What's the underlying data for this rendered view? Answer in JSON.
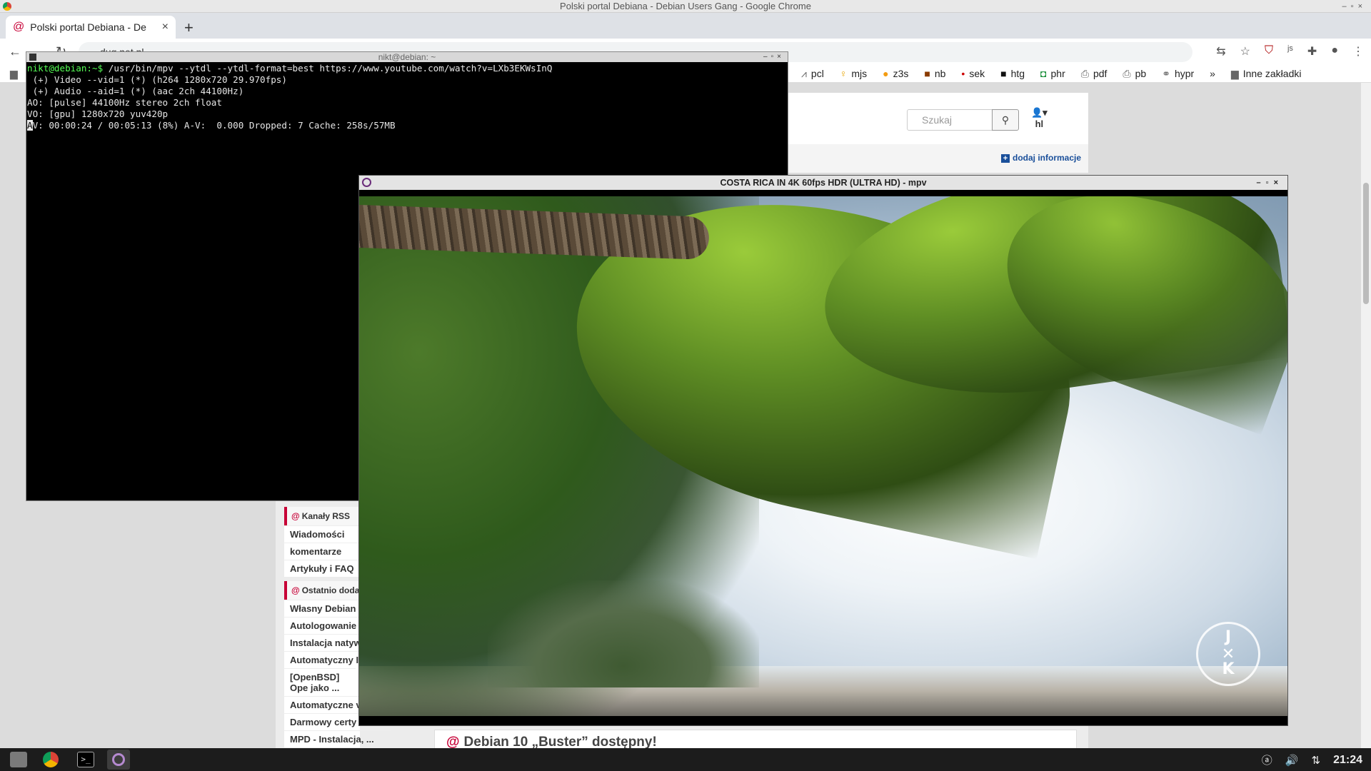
{
  "window": {
    "title": "Polski portal Debiana - Debian Users Gang - Google Chrome"
  },
  "tab": {
    "title": "Polski portal Debiana - De",
    "close": "×",
    "new": "+"
  },
  "toolbar": {
    "url": "dug.net.pl"
  },
  "bookmarks": {
    "items": [
      {
        "label": "pcl",
        "icon": "chart-icon"
      },
      {
        "label": "mjs",
        "icon": "bulb-icon"
      },
      {
        "label": "z3s",
        "icon": "shield-icon"
      },
      {
        "label": "nb",
        "icon": "box-icon"
      },
      {
        "label": "sek",
        "icon": "dot-icon"
      },
      {
        "label": "htg",
        "icon": "htg-icon"
      },
      {
        "label": "phr",
        "icon": "chat-icon"
      },
      {
        "label": "pdf",
        "icon": "printer-icon"
      },
      {
        "label": "pb",
        "icon": "printer-icon"
      },
      {
        "label": "hypr",
        "icon": "link-icon"
      }
    ],
    "more": "»",
    "other": "Inne zakładki"
  },
  "site": {
    "search_placeholder": "Szukaj",
    "user_label": "hl",
    "add_info": "dodaj informacje",
    "rss_heading": "Kanały RSS",
    "rss_items": [
      "Wiadomości",
      "komentarze",
      "Artykuły i FAQ"
    ],
    "recent_heading": "Ostatnio dodan",
    "recent_items": [
      "Własny Debian",
      "Autologowanie",
      "Instalacja natyw",
      "Automatyczny I",
      "[OpenBSD] Ope jako ...",
      "Automatyczne v",
      "Darmowy certy",
      "MPD - Instalacja, ..."
    ],
    "article_title": "Debian 10 „Buster” dostępny!"
  },
  "terminal": {
    "title": "nikt@debian: ~",
    "prompt": "nikt@debian:~$",
    "command": " /usr/bin/mpv --ytdl --ytdl-format=best https://www.youtube.com/watch?v=LXb3EKWsInQ",
    "lines": [
      " (+) Video --vid=1 (*) (h264 1280x720 29.970fps)",
      " (+) Audio --aid=1 (*) (aac 2ch 44100Hz)",
      "AO: [pulse] 44100Hz stereo 2ch float",
      "VO: [gpu] 1280x720 yuv420p"
    ],
    "status_cursor": "A",
    "status_rest": "V: 00:00:24 / 00:05:13 (8%) A-V:  0.000 Dropped: 7 Cache: 258s/57MB"
  },
  "mpv": {
    "title": "COSTA RICA IN 4K 60fps HDR (ULTRA HD) - mpv"
  },
  "taskbar": {
    "clock": "21:24"
  }
}
